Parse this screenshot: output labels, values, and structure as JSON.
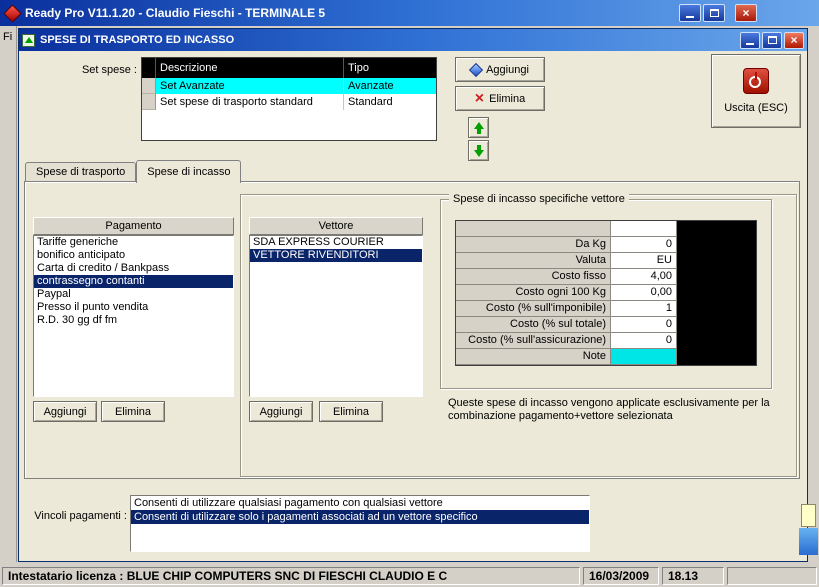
{
  "colors": {
    "titlebar_start": "#0a2f9c",
    "titlebar_end": "#6aa6ea",
    "selection_blue": "#0a246a",
    "selection_cyan": "#00ffff",
    "note_highlight": "#00e5e5",
    "close_red": "#b01800",
    "grid_header_bg": "#000000"
  },
  "main_window": {
    "title": "Ready Pro V11.1.20 - Claudio Fieschi - TERMINALE 5",
    "menu_partial": "Fi"
  },
  "dialog": {
    "title": "SPESE DI TRASPORTO ED INCASSO",
    "set_spese": {
      "label": "Set spese :",
      "columns": [
        "Descrizione",
        "Tipo"
      ],
      "rows": [
        {
          "descrizione": "Set Avanzate",
          "tipo": "Avanzate"
        },
        {
          "descrizione": "Set spese di trasporto standard",
          "tipo": "Standard"
        }
      ],
      "selected_index": 0,
      "add_label": "Aggiungi",
      "delete_label": "Elimina"
    },
    "exit_label": "Uscita (ESC)",
    "tabs": [
      {
        "label": "Spese di trasporto",
        "active": false
      },
      {
        "label": "Spese di incasso",
        "active": true
      }
    ],
    "pagamento": {
      "header": "Pagamento",
      "items": [
        "Tariffe generiche",
        "bonifico anticipato",
        "Carta di credito / Bankpass",
        "contrassegno contanti",
        "Paypal",
        "Presso il punto vendita",
        "R.D. 30 gg df fm"
      ],
      "selected_index": 3,
      "add_label": "Aggiungi",
      "delete_label": "Elimina"
    },
    "vettore": {
      "header": "Vettore",
      "items": [
        "SDA EXPRESS COURIER",
        "VETTORE RIVENDITORI"
      ],
      "selected_index": 1,
      "add_label": "Aggiungi",
      "delete_label": "Elimina"
    },
    "spese_incasso": {
      "group_title": "Spese di incasso specifiche vettore",
      "fields": [
        {
          "label": "",
          "value": ""
        },
        {
          "label": "Da Kg",
          "value": "0"
        },
        {
          "label": "Valuta",
          "value": "EU"
        },
        {
          "label": "Costo fisso",
          "value": "4,00"
        },
        {
          "label": "Costo ogni 100 Kg",
          "value": "0,00"
        },
        {
          "label": "Costo (% sull'imponibile)",
          "value": "1"
        },
        {
          "label": "Costo (% sul totale)",
          "value": "0"
        },
        {
          "label": "Costo (% sull'assicurazione)",
          "value": "0"
        },
        {
          "label": "Note",
          "value": "",
          "highlighted": true
        }
      ],
      "note": "Queste spese di incasso vengono applicate esclusivamente per la combinazione pagamento+vettore selezionata"
    },
    "vincoli": {
      "label": "Vincoli pagamenti :",
      "options": [
        "Consenti di utilizzare qualsiasi pagamento con qualsiasi vettore",
        "Consenti di utilizzare solo i pagamenti associati ad un vettore specifico"
      ],
      "selected_index": 1
    }
  },
  "statusbar": {
    "license": "Intestatario licenza : BLUE CHIP COMPUTERS SNC DI FIESCHI CLAUDIO E C",
    "date": "16/03/2009",
    "time": "18.13"
  }
}
